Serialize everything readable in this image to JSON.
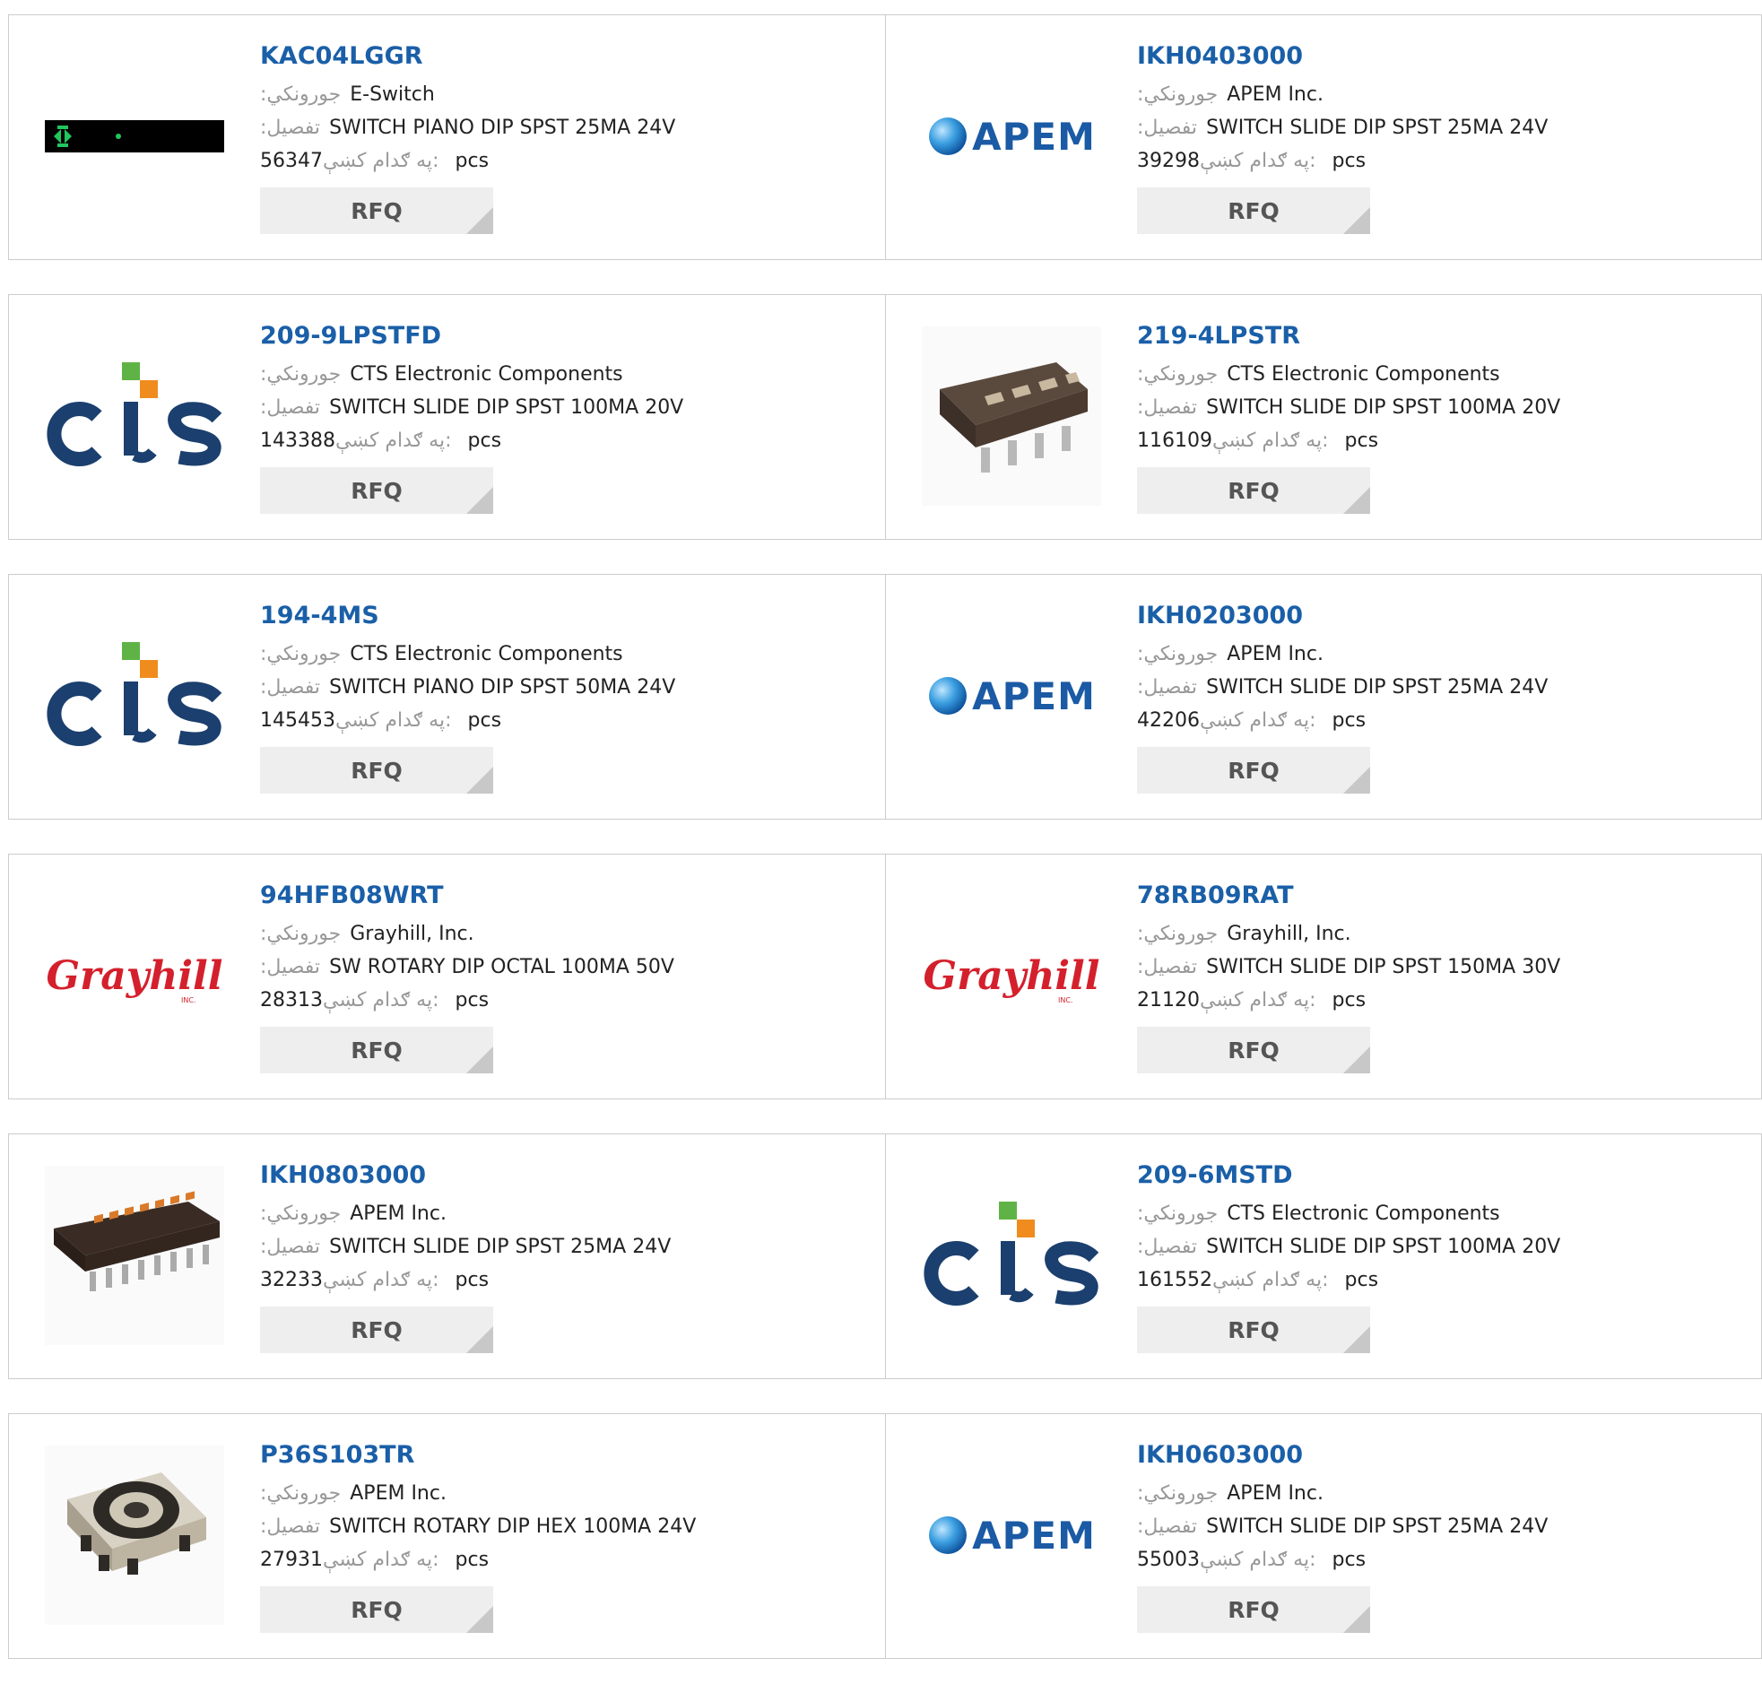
{
  "labels": {
    "manufacturer": ":جورونكي",
    "description": ":تفصيل",
    "stock": "په ګدام کښې:",
    "unit": "pcs",
    "rfq": "RFQ"
  },
  "logos": {
    "cts": "cts",
    "apem": "APEM",
    "grayhill": "Grayhill",
    "grayhill_sub": "INC."
  },
  "colors": {
    "part_link": "#1a5fa8",
    "label_gray": "#999999",
    "button_bg": "#eeeeee",
    "cts_blue": "#1b3f6e",
    "cts_green": "#5fb346",
    "cts_orange": "#f08c1e",
    "apem_blue": "#1b5aa4",
    "grayhill_red": "#d4202c"
  },
  "products": [
    {
      "part": "KAC04LGGR",
      "manufacturer": "E-Switch",
      "description": "SWITCH PIANO DIP SPST 25MA 24V",
      "stock": "56347",
      "image": "keyboard-strip-icon"
    },
    {
      "part": "IKH0403000",
      "manufacturer": "APEM Inc.",
      "description": "SWITCH SLIDE DIP SPST 25MA 24V",
      "stock": "39298",
      "image": "apem-logo"
    },
    {
      "part": "209-9LPSTFD",
      "manufacturer": "CTS Electronic Components",
      "description": "SWITCH SLIDE DIP SPST 100MA 20V",
      "stock": "143388",
      "image": "cts-logo"
    },
    {
      "part": "219-4LPSTR",
      "manufacturer": "CTS Electronic Components",
      "description": "SWITCH SLIDE DIP SPST 100MA 20V",
      "stock": "116109",
      "image": "dip-switch-4-photo"
    },
    {
      "part": "194-4MS",
      "manufacturer": "CTS Electronic Components",
      "description": "SWITCH PIANO DIP SPST 50MA 24V",
      "stock": "145453",
      "image": "cts-logo"
    },
    {
      "part": "IKH0203000",
      "manufacturer": "APEM Inc.",
      "description": "SWITCH SLIDE DIP SPST 25MA 24V",
      "stock": "42206",
      "image": "apem-logo"
    },
    {
      "part": "94HFB08WRT",
      "manufacturer": "Grayhill, Inc.",
      "description": "SW ROTARY DIP OCTAL 100MA 50V",
      "stock": "28313",
      "image": "grayhill-logo"
    },
    {
      "part": "78RB09RAT",
      "manufacturer": "Grayhill, Inc.",
      "description": "SWITCH SLIDE DIP SPST 150MA 30V",
      "stock": "21120",
      "image": "grayhill-logo"
    },
    {
      "part": "IKH0803000",
      "manufacturer": "APEM Inc.",
      "description": "SWITCH SLIDE DIP SPST 25MA 24V",
      "stock": "32233",
      "image": "dip-switch-8-photo"
    },
    {
      "part": "209-6MSTD",
      "manufacturer": "CTS Electronic Components",
      "description": "SWITCH SLIDE DIP SPST 100MA 20V",
      "stock": "161552",
      "image": "cts-logo"
    },
    {
      "part": "P36S103TR",
      "manufacturer": "APEM Inc.",
      "description": "SWITCH ROTARY DIP HEX 100MA 24V",
      "stock": "27931",
      "image": "rotary-dip-photo"
    },
    {
      "part": "IKH0603000",
      "manufacturer": "APEM Inc.",
      "description": "SWITCH SLIDE DIP SPST 25MA 24V",
      "stock": "55003",
      "image": "apem-logo"
    }
  ]
}
